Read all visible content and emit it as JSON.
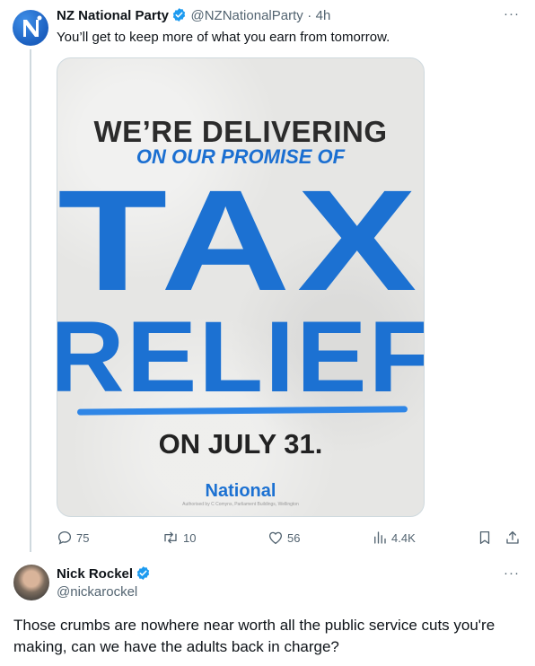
{
  "tweet": {
    "author_name": "NZ National Party",
    "handle": "@NZNationalParty",
    "separator": "·",
    "time": "4h",
    "text": "You’ll get to keep more of what you earn from tomorrow.",
    "more_label": "···",
    "media": {
      "line1": "WE’RE DELIVERING",
      "line2": "ON OUR PROMISE OF",
      "line3": "TAX",
      "line4": "RELIEF",
      "line5": "ON JULY 31.",
      "logo": "National",
      "fine_print": "Authorised by C Comyns, Parliament Buildings, Wellington"
    },
    "actions": {
      "replies": "75",
      "retweets": "10",
      "likes": "56",
      "views": "4.4K"
    }
  },
  "reply": {
    "author_name": "Nick Rockel",
    "handle": "@nickarockel",
    "more_label": "···",
    "text": "Those crumbs are nowhere near worth all the public service cuts you're making, can we have the adults back in charge?"
  },
  "colors": {
    "accent": "#1d9bf0",
    "brand_blue": "#1c71d2",
    "muted_text": "#536471"
  },
  "icons": [
    "reply-icon",
    "retweet-icon",
    "like-icon",
    "views-icon",
    "bookmark-icon",
    "share-icon",
    "verified-badge-icon"
  ]
}
